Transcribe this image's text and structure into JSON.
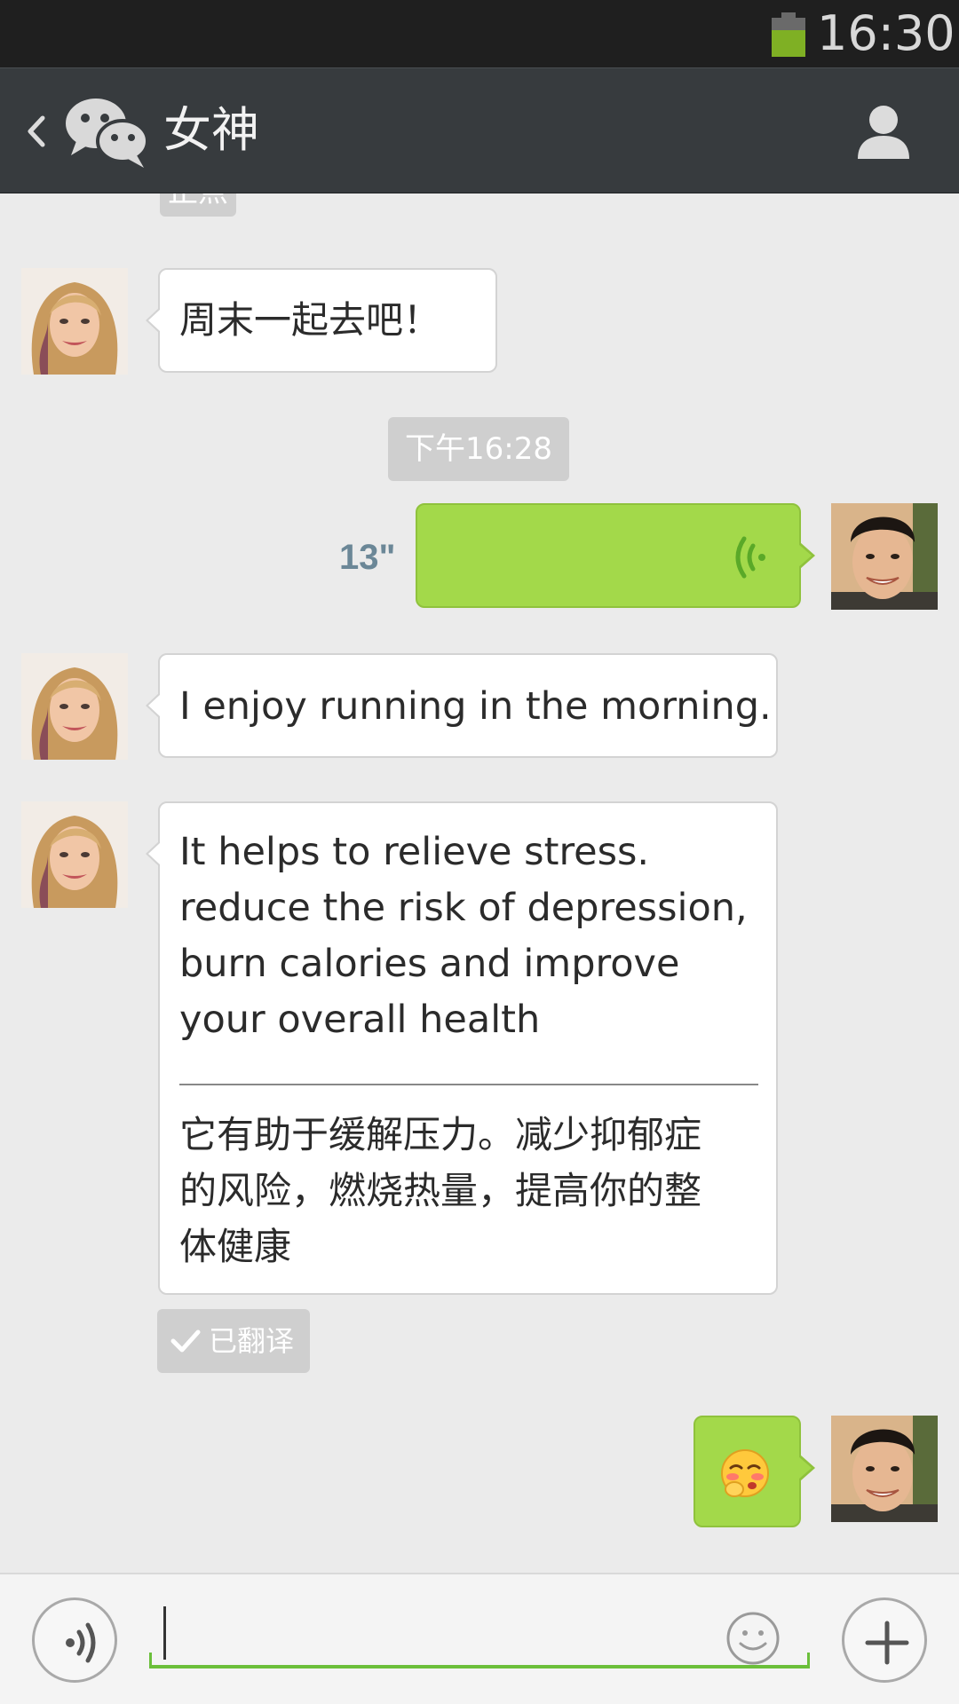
{
  "status_bar": {
    "time": "16:30",
    "battery_color": "#7fb024"
  },
  "header": {
    "title": "女神",
    "back_icon": "chevron-left-icon",
    "logo_icon": "wechat-logo-icon",
    "profile_icon": "person-icon"
  },
  "messages": {
    "partial_timestamp": "正点",
    "m1_text": "周末一起去吧！",
    "timestamp": "下午16:28",
    "voice_duration": "13\"",
    "m3_text": "I enjoy running in the morning.",
    "m4_lines": [
      "It helps to relieve stress.",
      "reduce the risk of depression,",
      "burn calories and improve",
      "your overall health"
    ],
    "m4_translation_lines": [
      "它有助于缓解压力。减少抑郁症",
      "的风险，燃烧热量，提高你的整",
      "体健康"
    ],
    "translated_label": "已翻译",
    "emoji": "blushing-emoji"
  },
  "input_bar": {
    "value": "",
    "voice_icon": "voice-input-icon",
    "emoji_icon": "smiley-icon",
    "plus_icon": "plus-icon"
  },
  "colors": {
    "accent_green": "#6bbf3a",
    "bubble_out": "#a3d94a",
    "header_bg": "#373b3e"
  }
}
